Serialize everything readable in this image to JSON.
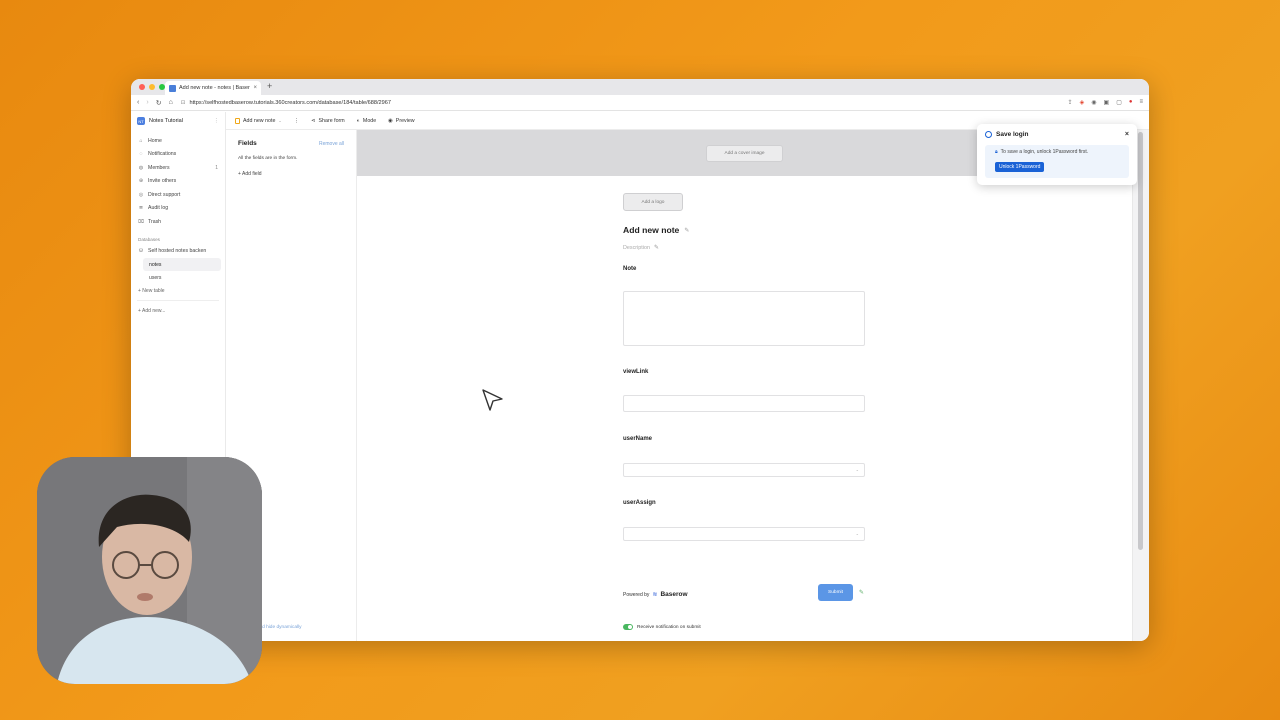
{
  "browser": {
    "tab_title": "Add new note - notes | Basero...",
    "url": "https://selfhostedbaserow.tutorials.360creators.com/database/184/table/688/2967",
    "new_tab": "+"
  },
  "sidebar": {
    "workspace": "Notes Tutorial",
    "nav": [
      {
        "label": "Home",
        "icon": "home-icon",
        "badge": ""
      },
      {
        "label": "Notifications",
        "icon": "bell-icon",
        "badge": ""
      },
      {
        "label": "Members",
        "icon": "users-icon",
        "badge": "1"
      },
      {
        "label": "Invite others",
        "icon": "user-plus-icon",
        "badge": ""
      },
      {
        "label": "Direct support",
        "icon": "support-icon",
        "badge": ""
      },
      {
        "label": "Audit log",
        "icon": "log-icon",
        "badge": ""
      },
      {
        "label": "Trash",
        "icon": "trash-icon",
        "badge": ""
      }
    ],
    "databases_heading": "Databases",
    "database_name": "Self hosted notes backen",
    "tables": [
      "notes",
      "users"
    ],
    "new_table": "+ New table",
    "add_new": "+ Add new..."
  },
  "toolbar": {
    "view_name": "Add new note",
    "share_form": "Share form",
    "mode": "Mode",
    "preview": "Preview"
  },
  "fields_panel": {
    "title": "Fields",
    "remove_all": "Remove all",
    "note": "All the fields are in the form.",
    "add_field": "+ Add field",
    "bottom_link": "ld hide dynamically"
  },
  "form": {
    "cover_button": "Add a cover image",
    "logo_button": "Add a logo",
    "title": "Add new note",
    "description_placeholder": "Description",
    "fields": [
      {
        "label": "Note",
        "type": "textarea"
      },
      {
        "label": "viewLink",
        "type": "text"
      },
      {
        "label": "userName",
        "type": "select"
      },
      {
        "label": "userAssign",
        "type": "select"
      }
    ],
    "powered_by": "Powered by",
    "brand": "Baserow",
    "submit": "Submit",
    "receive_notification": "Receive notification on submit"
  },
  "password_popup": {
    "title": "Save login",
    "message": "To save a login, unlock 1Password first.",
    "button": "Unlock 1Password"
  },
  "colors": {
    "background": "#f0951a",
    "accent": "#5b96e6",
    "onepassword": "#1a62d6",
    "toggle_on": "#49b760"
  }
}
